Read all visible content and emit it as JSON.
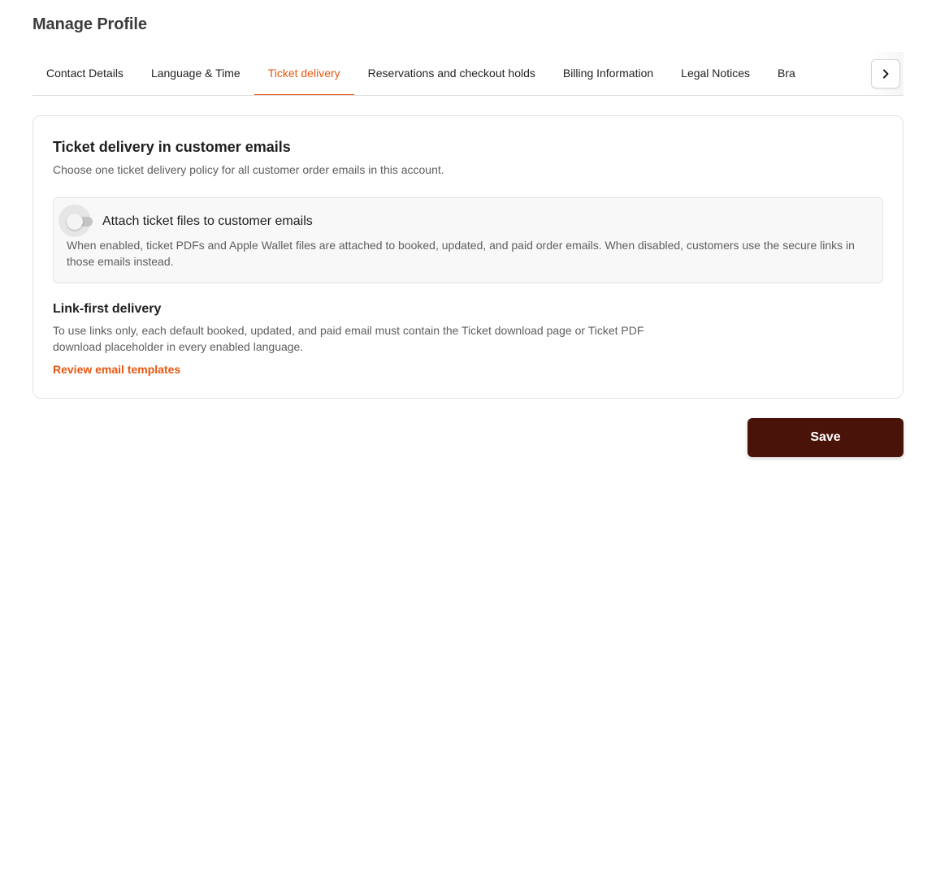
{
  "page": {
    "title": "Manage Profile"
  },
  "tabs": [
    {
      "label": "Contact Details",
      "active": false
    },
    {
      "label": "Language & Time",
      "active": false
    },
    {
      "label": "Ticket delivery",
      "active": true
    },
    {
      "label": "Reservations and checkout holds",
      "active": false
    },
    {
      "label": "Billing Information",
      "active": false
    },
    {
      "label": "Legal Notices",
      "active": false
    },
    {
      "label": "Bra",
      "active": false
    }
  ],
  "tab_scroll": {
    "icon": "chevron-right-icon"
  },
  "card": {
    "title": "Ticket delivery in customer emails",
    "subtitle": "Choose one ticket delivery policy for all customer order emails in this account.",
    "option": {
      "label": "Attach ticket files to customer emails",
      "description": "When enabled, ticket PDFs and Apple Wallet files are attached to booked, updated, and paid order emails. When disabled, customers use the secure links in those emails instead.",
      "enabled": false
    },
    "link_first": {
      "title": "Link-first delivery",
      "description": "To use links only, each default booked, updated, and paid email must contain the Ticket download page or Ticket PDF download placeholder in every enabled language.",
      "link_label": "Review email templates"
    }
  },
  "actions": {
    "save_label": "Save"
  },
  "colors": {
    "accent": "#e8560f",
    "primary_button": "#4a130a",
    "title": "#3c3c3c",
    "muted_text": "#5e5e5e"
  }
}
